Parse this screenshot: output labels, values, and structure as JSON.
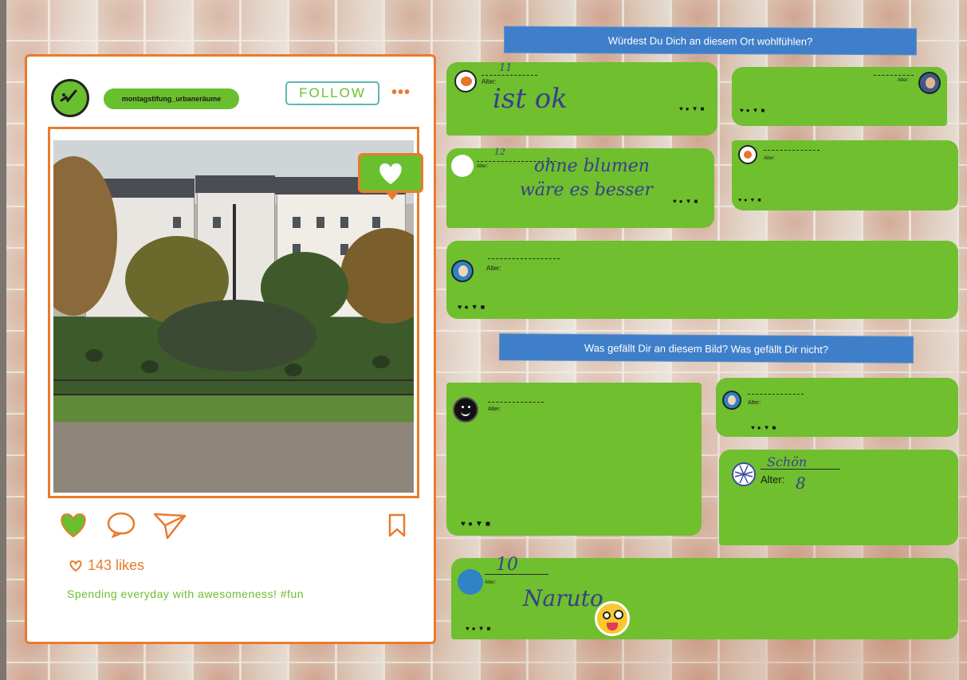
{
  "post": {
    "handle": "montagstifung_urbaneräume",
    "follow_label": "FOLLOW",
    "more_label": "•••",
    "likes_text": "143 likes",
    "caption": "Spending everyday with awesomeness! #fun"
  },
  "banners": {
    "q1": "Würdest Du Dich an diesem Ort wohlfühlen?",
    "q2": "Was gefällt Dir an diesem Bild? Was gefällt Dir nicht?"
  },
  "comments": {
    "c1": {
      "age_label": "Alter:",
      "age_value": "11",
      "text": "ist ok"
    },
    "c2": {
      "age_label": "Alter:"
    },
    "c3": {
      "age_label": "Alter:",
      "age_value": "12",
      "text_line1": "ohne blumen",
      "text_line2": "wäre es besser"
    },
    "c4": {
      "age_label": "Alter:"
    },
    "c5": {
      "age_label": "Alter:"
    },
    "c6": {
      "age_label": "Alter:"
    },
    "c7": {
      "age_label": "Alter:"
    },
    "c8": {
      "age_label": "Alter:",
      "name": "Schön",
      "age_value": "8"
    },
    "c9": {
      "age_label": "Alter:",
      "age_value": "10",
      "text": "Naruto"
    }
  },
  "reactions": "♥●▼■",
  "colors": {
    "accent_orange": "#e87b2e",
    "bubble_green": "#6fbf2e",
    "banner_blue": "#3f7fc9",
    "follow_teal": "#5fb8b0"
  }
}
